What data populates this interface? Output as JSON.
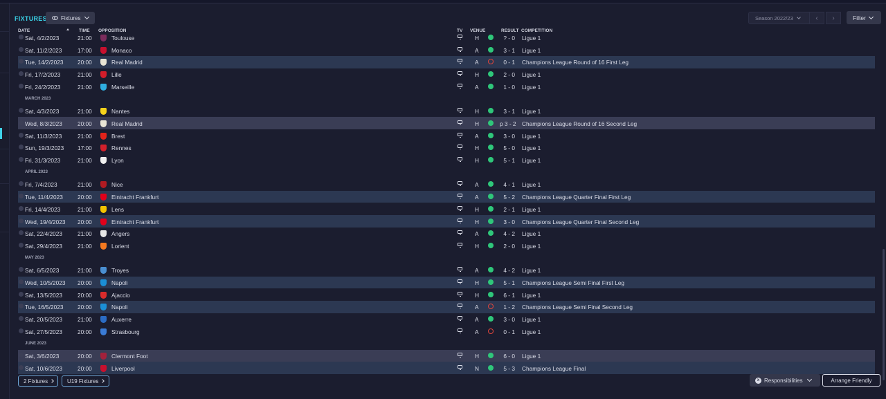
{
  "header": {
    "title": "FIXTURES",
    "view_dropdown": "Fixtures",
    "season_select": "Season 2022/23",
    "prev_icon": "‹",
    "next_icon": "›",
    "filter_label": "Filter"
  },
  "columns": {
    "date": "DATE",
    "time": "TIME",
    "opposition": "OPPOSITION",
    "tv": "TV",
    "venue": "VENUE",
    "result": "RESULT",
    "competition": "COMPETITION"
  },
  "rows": [
    {
      "kind": "match",
      "date": "Sat, 4/2/2023",
      "time": "21:00",
      "opp": "Toulouse",
      "venue": "H",
      "outcome": "W",
      "result": "? - 0",
      "comp": "Ligue 1",
      "badge": "#7b2c5c"
    },
    {
      "kind": "match",
      "date": "Sat, 11/2/2023",
      "time": "17:00",
      "opp": "Monaco",
      "venue": "A",
      "outcome": "W",
      "result": "3 - 1",
      "comp": "Ligue 1",
      "badge": "#c8102e"
    },
    {
      "kind": "match",
      "date": "Tue, 14/2/2023",
      "time": "20:00",
      "opp": "Real Madrid",
      "venue": "A",
      "outcome": "L",
      "result": "0 - 1",
      "comp": "Champions League Round of 16 First Leg",
      "badge": "#e8e4d4",
      "style": "alt"
    },
    {
      "kind": "match",
      "date": "Fri, 17/2/2023",
      "time": "21:00",
      "opp": "Lille",
      "venue": "H",
      "outcome": "W",
      "result": "2 - 0",
      "comp": "Ligue 1",
      "badge": "#d31d2a"
    },
    {
      "kind": "match",
      "date": "Fri, 24/2/2023",
      "time": "21:00",
      "opp": "Marseille",
      "venue": "A",
      "outcome": "W",
      "result": "1 - 0",
      "comp": "Ligue 1",
      "badge": "#2faee0"
    },
    {
      "kind": "month",
      "label": "MARCH 2023"
    },
    {
      "kind": "match",
      "date": "Sat, 4/3/2023",
      "time": "21:00",
      "opp": "Nantes",
      "venue": "H",
      "outcome": "W",
      "result": "3 - 1",
      "comp": "Ligue 1",
      "badge": "#f5d21b"
    },
    {
      "kind": "match",
      "date": "Wed, 8/3/2023",
      "time": "20:00",
      "opp": "Real Madrid",
      "venue": "H",
      "outcome": "W",
      "result": "p 3 - 2",
      "comp": "Champions League Round of 16 Second Leg",
      "badge": "#e8e4d4",
      "style": "hl"
    },
    {
      "kind": "match",
      "date": "Sat, 11/3/2023",
      "time": "21:00",
      "opp": "Brest",
      "venue": "A",
      "outcome": "W",
      "result": "3 - 0",
      "comp": "Ligue 1",
      "badge": "#e2231a"
    },
    {
      "kind": "match",
      "date": "Sun, 19/3/2023",
      "time": "17:00",
      "opp": "Rennes",
      "venue": "H",
      "outcome": "W",
      "result": "5 - 0",
      "comp": "Ligue 1",
      "badge": "#d4202b"
    },
    {
      "kind": "match",
      "date": "Fri, 31/3/2023",
      "time": "21:00",
      "opp": "Lyon",
      "venue": "H",
      "outcome": "W",
      "result": "5 - 1",
      "comp": "Ligue 1",
      "badge": "#f0f0f0"
    },
    {
      "kind": "month",
      "label": "APRIL 2023"
    },
    {
      "kind": "match",
      "date": "Fri, 7/4/2023",
      "time": "21:00",
      "opp": "Nice",
      "venue": "A",
      "outcome": "W",
      "result": "4 - 1",
      "comp": "Ligue 1",
      "badge": "#b01b22"
    },
    {
      "kind": "match",
      "date": "Tue, 11/4/2023",
      "time": "20:00",
      "opp": "Eintracht Frankfurt",
      "venue": "A",
      "outcome": "W",
      "result": "5 - 2",
      "comp": "Champions League Quarter Final First Leg",
      "badge": "#e1001a",
      "style": "alt"
    },
    {
      "kind": "match",
      "date": "Fri, 14/4/2023",
      "time": "21:00",
      "opp": "Lens",
      "venue": "H",
      "outcome": "W",
      "result": "2 - 1",
      "comp": "Ligue 1",
      "badge": "#f2c300"
    },
    {
      "kind": "match",
      "date": "Wed, 19/4/2023",
      "time": "20:00",
      "opp": "Eintracht Frankfurt",
      "venue": "H",
      "outcome": "W",
      "result": "3 - 0",
      "comp": "Champions League Quarter Final Second Leg",
      "badge": "#e1001a",
      "style": "alt"
    },
    {
      "kind": "match",
      "date": "Sat, 22/4/2023",
      "time": "21:00",
      "opp": "Angers",
      "venue": "A",
      "outcome": "W",
      "result": "4 - 2",
      "comp": "Ligue 1",
      "badge": "#e6e6e6"
    },
    {
      "kind": "match",
      "date": "Sat, 29/4/2023",
      "time": "21:00",
      "opp": "Lorient",
      "venue": "H",
      "outcome": "W",
      "result": "2 - 0",
      "comp": "Ligue 1",
      "badge": "#f47920"
    },
    {
      "kind": "month",
      "label": "MAY 2023"
    },
    {
      "kind": "match",
      "date": "Sat, 6/5/2023",
      "time": "21:00",
      "opp": "Troyes",
      "venue": "A",
      "outcome": "W",
      "result": "4 - 2",
      "comp": "Ligue 1",
      "badge": "#4a8fd1"
    },
    {
      "kind": "match",
      "date": "Wed, 10/5/2023",
      "time": "20:00",
      "opp": "Napoli",
      "venue": "H",
      "outcome": "W",
      "result": "5 - 1",
      "comp": "Champions League Semi Final First Leg",
      "badge": "#1b8fd6",
      "style": "alt"
    },
    {
      "kind": "match",
      "date": "Sat, 13/5/2023",
      "time": "20:00",
      "opp": "Ajaccio",
      "venue": "H",
      "outcome": "W",
      "result": "6 - 1",
      "comp": "Ligue 1",
      "badge": "#d92b2b"
    },
    {
      "kind": "match",
      "date": "Tue, 16/5/2023",
      "time": "20:00",
      "opp": "Napoli",
      "venue": "A",
      "outcome": "L",
      "result": "1 - 2",
      "comp": "Champions League Semi Final Second Leg",
      "badge": "#1b8fd6",
      "style": "alt"
    },
    {
      "kind": "match",
      "date": "Sat, 20/5/2023",
      "time": "21:00",
      "opp": "Auxerre",
      "venue": "A",
      "outcome": "W",
      "result": "3 - 0",
      "comp": "Ligue 1",
      "badge": "#2b6cc4"
    },
    {
      "kind": "match",
      "date": "Sat, 27/5/2023",
      "time": "20:00",
      "opp": "Strasbourg",
      "venue": "A",
      "outcome": "L",
      "result": "0 - 1",
      "comp": "Ligue 1",
      "badge": "#3a7bd5"
    },
    {
      "kind": "month",
      "label": "JUNE 2023"
    },
    {
      "kind": "match",
      "date": "Sat, 3/6/2023",
      "time": "20:00",
      "opp": "Clermont Foot",
      "venue": "H",
      "outcome": "W",
      "result": "6 - 0",
      "comp": "Ligue 1",
      "badge": "#a3213b",
      "style": "hl"
    },
    {
      "kind": "match",
      "date": "Sat, 10/6/2023",
      "time": "20:00",
      "opp": "Liverpool",
      "venue": "N",
      "outcome": "W",
      "result": "5 - 3",
      "comp": "Champions League Final",
      "badge": "#c8102e",
      "style": "alt"
    }
  ],
  "footer": {
    "fixtures_btn": "2 Fixtures",
    "u19_btn": "U19 Fixtures",
    "responsibilities": "Responsibilities",
    "arrange_friendly": "Arrange Friendly"
  }
}
